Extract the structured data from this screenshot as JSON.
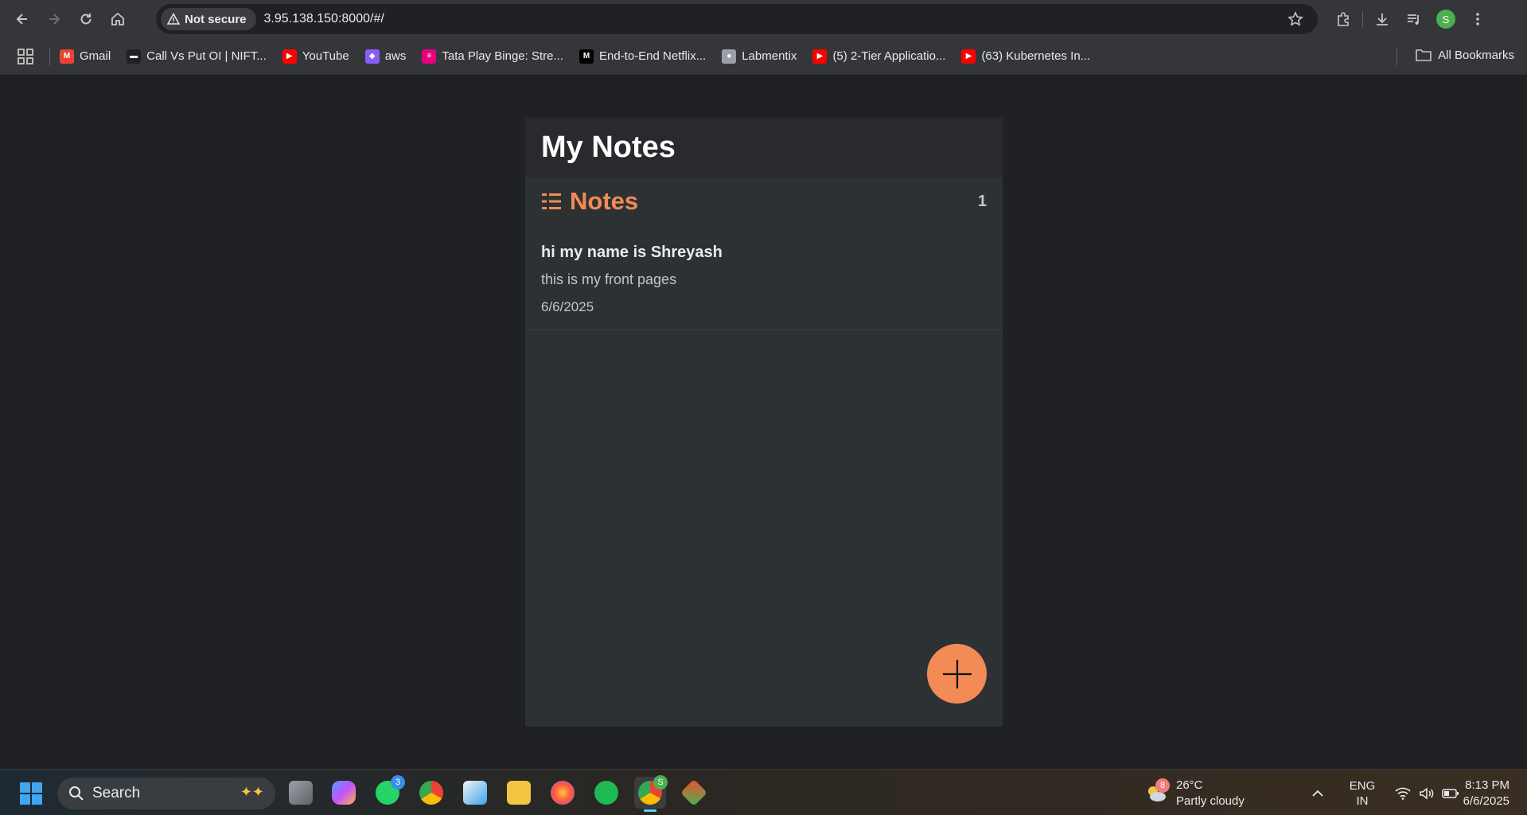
{
  "browser": {
    "security_label": "Not secure",
    "url": "3.95.138.150:8000/#/",
    "profile_initial": "S",
    "bookmarks": [
      {
        "label": "Gmail",
        "color": "#ea4335",
        "glyph": "M"
      },
      {
        "label": "Call Vs Put OI | NIFT...",
        "color": "#202124",
        "glyph": "▬"
      },
      {
        "label": "YouTube",
        "color": "#ff0000",
        "glyph": "▶"
      },
      {
        "label": "aws",
        "color": "#8a5cf6",
        "glyph": "◆"
      },
      {
        "label": "Tata Play Binge: Stre...",
        "color": "#e6007e",
        "glyph": "≡"
      },
      {
        "label": "End-to-End Netflix...",
        "color": "#000000",
        "glyph": "M"
      },
      {
        "label": "Labmentix",
        "color": "#9aa0a6",
        "glyph": "●"
      },
      {
        "label": "(5) 2-Tier Applicatio...",
        "color": "#ff0000",
        "glyph": "▶"
      },
      {
        "label": "(63) Kubernetes In...",
        "color": "#ff0000",
        "glyph": "▶"
      }
    ],
    "all_bookmarks_label": "All Bookmarks"
  },
  "app": {
    "title": "My Notes",
    "section_title": "Notes",
    "note_count": "1",
    "accent_color": "#f28b55",
    "notes": [
      {
        "title": "hi my name is Shreyash",
        "body": "this is my front pages",
        "date": "6/6/2025"
      }
    ]
  },
  "taskbar": {
    "search_label": "Search",
    "whatsapp_badge": "3",
    "chrome_profile_badge": "S",
    "weather_temp": "26°C",
    "weather_desc": "Partly cloudy",
    "weather_badge": "8",
    "lang_line1": "ENG",
    "lang_line2": "IN",
    "time": "8:13 PM",
    "date": "6/6/2025"
  }
}
